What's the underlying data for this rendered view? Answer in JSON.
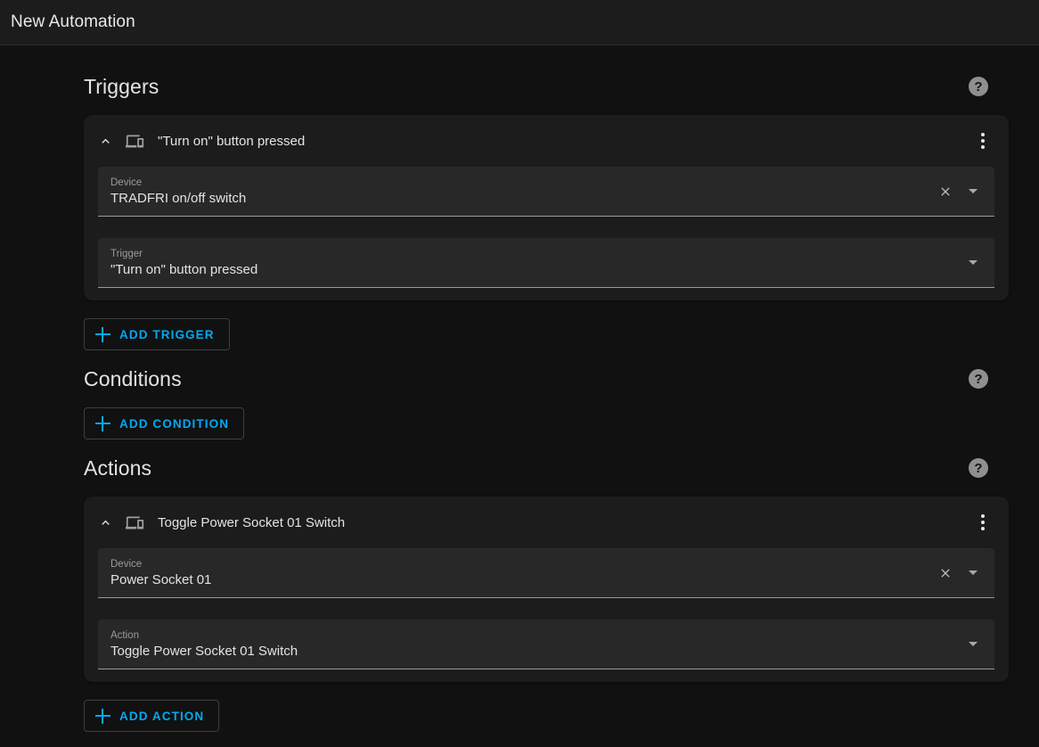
{
  "toolbar": {
    "title": "New Automation"
  },
  "sections": {
    "triggers": {
      "heading": "Triggers",
      "help_icon": "help-circle-icon",
      "help_label": "?",
      "add_button": "ADD TRIGGER",
      "card": {
        "collapse_icon": "chevron-up-icon",
        "type_icon": "devices-icon",
        "title": "\"Turn on\" button pressed",
        "menu_icon": "dots-vertical-icon",
        "fields": [
          {
            "label": "Device",
            "value": "TRADFRI on/off switch",
            "clear_icon": "close-icon",
            "caret_icon": "chevron-down-icon",
            "has_clear": true
          },
          {
            "label": "Trigger",
            "value": "\"Turn on\" button pressed",
            "caret_icon": "chevron-down-icon",
            "has_clear": false
          }
        ]
      }
    },
    "conditions": {
      "heading": "Conditions",
      "help_icon": "help-circle-icon",
      "help_label": "?",
      "add_button": "ADD CONDITION"
    },
    "actions": {
      "heading": "Actions",
      "help_icon": "help-circle-icon",
      "help_label": "?",
      "add_button": "ADD ACTION",
      "card": {
        "collapse_icon": "chevron-up-icon",
        "type_icon": "devices-icon",
        "title": "Toggle Power Socket 01 Switch",
        "menu_icon": "dots-vertical-icon",
        "fields": [
          {
            "label": "Device",
            "value": "Power Socket 01",
            "clear_icon": "close-icon",
            "caret_icon": "chevron-down-icon",
            "has_clear": true
          },
          {
            "label": "Action",
            "value": "Toggle Power Socket 01 Switch",
            "caret_icon": "chevron-down-icon",
            "has_clear": false
          }
        ]
      }
    }
  },
  "colors": {
    "accent": "#03a9f4",
    "page_background": "#111111",
    "card_background": "#1c1c1c",
    "field_background": "#282828",
    "text_primary": "#e4e4e4",
    "text_secondary": "#9b9b9b"
  }
}
